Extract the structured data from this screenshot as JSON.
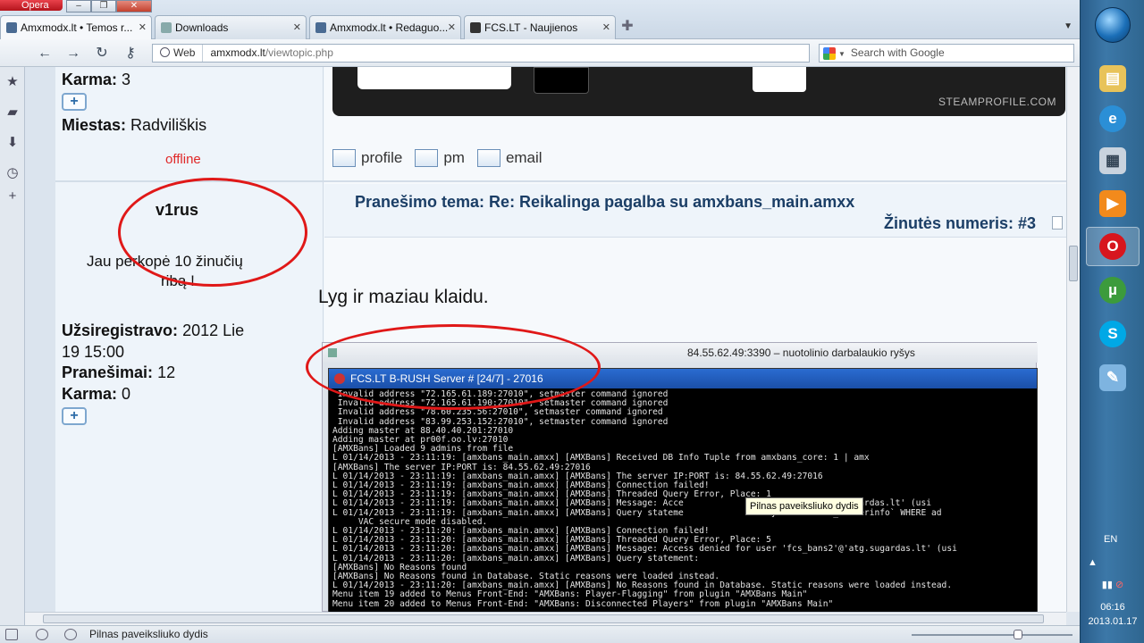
{
  "browser": {
    "opera_label": "Opera",
    "tabs": [
      {
        "label": "Amxmodx.lt • Temos r..."
      },
      {
        "label": "Downloads"
      },
      {
        "label": "Amxmodx.lt • Redaguo..."
      },
      {
        "label": "FCS.LT - Naujienos"
      }
    ],
    "web_label": "Web",
    "url_host": "amxmodx.lt",
    "url_path": "/viewtopic.php",
    "search_placeholder": "Search with Google",
    "status_text": "Pilnas paveiksliuko dydis"
  },
  "post_prev": {
    "karma_label": "Karma:",
    "karma_value": "3",
    "city_label": "Miestas:",
    "city_value": "Radviliškis",
    "status": "offline",
    "banner_text": "STEAMPROFILE.COM",
    "actions": [
      "profile",
      "pm",
      "email"
    ]
  },
  "post": {
    "author": "v1rus",
    "rank_line1": "Jau perkopė 10 žinučių",
    "rank_line2": "ribą !",
    "registered_label": "Užsiregistravo:",
    "registered_value_1": "2012 Lie",
    "registered_value_2": "19 15:00",
    "posts_label": "Pranešimai:",
    "posts_value": "12",
    "karma_label": "Karma:",
    "karma_value": "0",
    "topic": "Pranešimo tema: Re: Reikalinga pagalba su amxbans_main.amxx",
    "post_number": "Žinutės numeris: #3",
    "body": "Lyg ir maziau klaidu.",
    "screenshot": {
      "rdp_title": "84.55.62.49:3390 – nuotolinio darbalaukio ryšys",
      "console_title": "FCS.LT B-RUSH Server # [24/7] - 27016",
      "lines": [
        " Invalid address \"72.165.61.189:27010\", setmaster command ignored",
        " Invalid address \"72.165.61.190:27010\", setmaster command ignored",
        " Invalid address \"78.60.235.56:27010\", setmaster command ignored",
        " Invalid address \"83.99.253.152:27010\", setmaster command ignored",
        "Adding master at 88.40.40.201:27010",
        "Adding master at pr00f.oo.lv:27010",
        "[AMXBans] Loaded 9 admins from file",
        "L 01/14/2013 - 23:11:19: [amxbans_main.amxx] [AMXBans] Received DB Info Tuple from amxbans_core: 1 | amx",
        "[AMXBans] The server IP:PORT is: 84.55.62.49:27016",
        "L 01/14/2013 - 23:11:19: [amxbans_main.amxx] [AMXBans] The server IP:PORT is: 84.55.62.49:27016",
        "L 01/14/2013 - 23:11:19: [amxbans_main.amxx] [AMXBans] Connection failed!",
        "L 01/14/2013 - 23:11:19: [amxbans_main.amxx] [AMXBans] Threaded Query Error, Place: 1",
        "L 01/14/2013 - 23:11:19: [amxbans_main.amxx] [AMXBans] Message: Acce                cs_bans2'@'atg.sugardas.lt' (usi",
        "L 01/14/2013 - 23:11:19: [amxbans_main.amxx] [AMXBans] Query stateme                ty` FROM `amx_serverinfo` WHERE ad",
        "     VAC secure mode disabled.",
        "L 01/14/2013 - 23:11:20: [amxbans_main.amxx] [AMXBans] Connection failed!",
        "L 01/14/2013 - 23:11:20: [amxbans_main.amxx] [AMXBans] Threaded Query Error, Place: 5",
        "L 01/14/2013 - 23:11:20: [amxbans_main.amxx] [AMXBans] Message: Access denied for user 'fcs_bans2'@'atg.sugardas.lt' (usi",
        "L 01/14/2013 - 23:11:20: [amxbans_main.amxx] [AMXBans] Query statement:",
        "[AMXBans] No Reasons found",
        "[AMXBans] No Reasons found in Database. Static reasons were loaded instead.",
        "L 01/14/2013 - 23:11:20: [amxbans_main.amxx] [AMXBans] No Reasons found in Database. Static reasons were loaded instead.",
        "Menu item 19 added to Menus Front-End: \"AMXBans: Player-Flagging\" from plugin \"AMXBans Main\"",
        "Menu item 20 added to Menus Front-End: \"AMXBans: Disconnected Players\" from plugin \"AMXBans Main\""
      ]
    },
    "tooltip": "Pilnas paveiksliuko dydis"
  },
  "taskbar": {
    "language": "EN",
    "time": "06:16",
    "date": "2013.01.17"
  },
  "colors": {
    "annotation_red": "#e01818",
    "topic_blue": "#1b3e66",
    "offline_red": "#e02828"
  }
}
